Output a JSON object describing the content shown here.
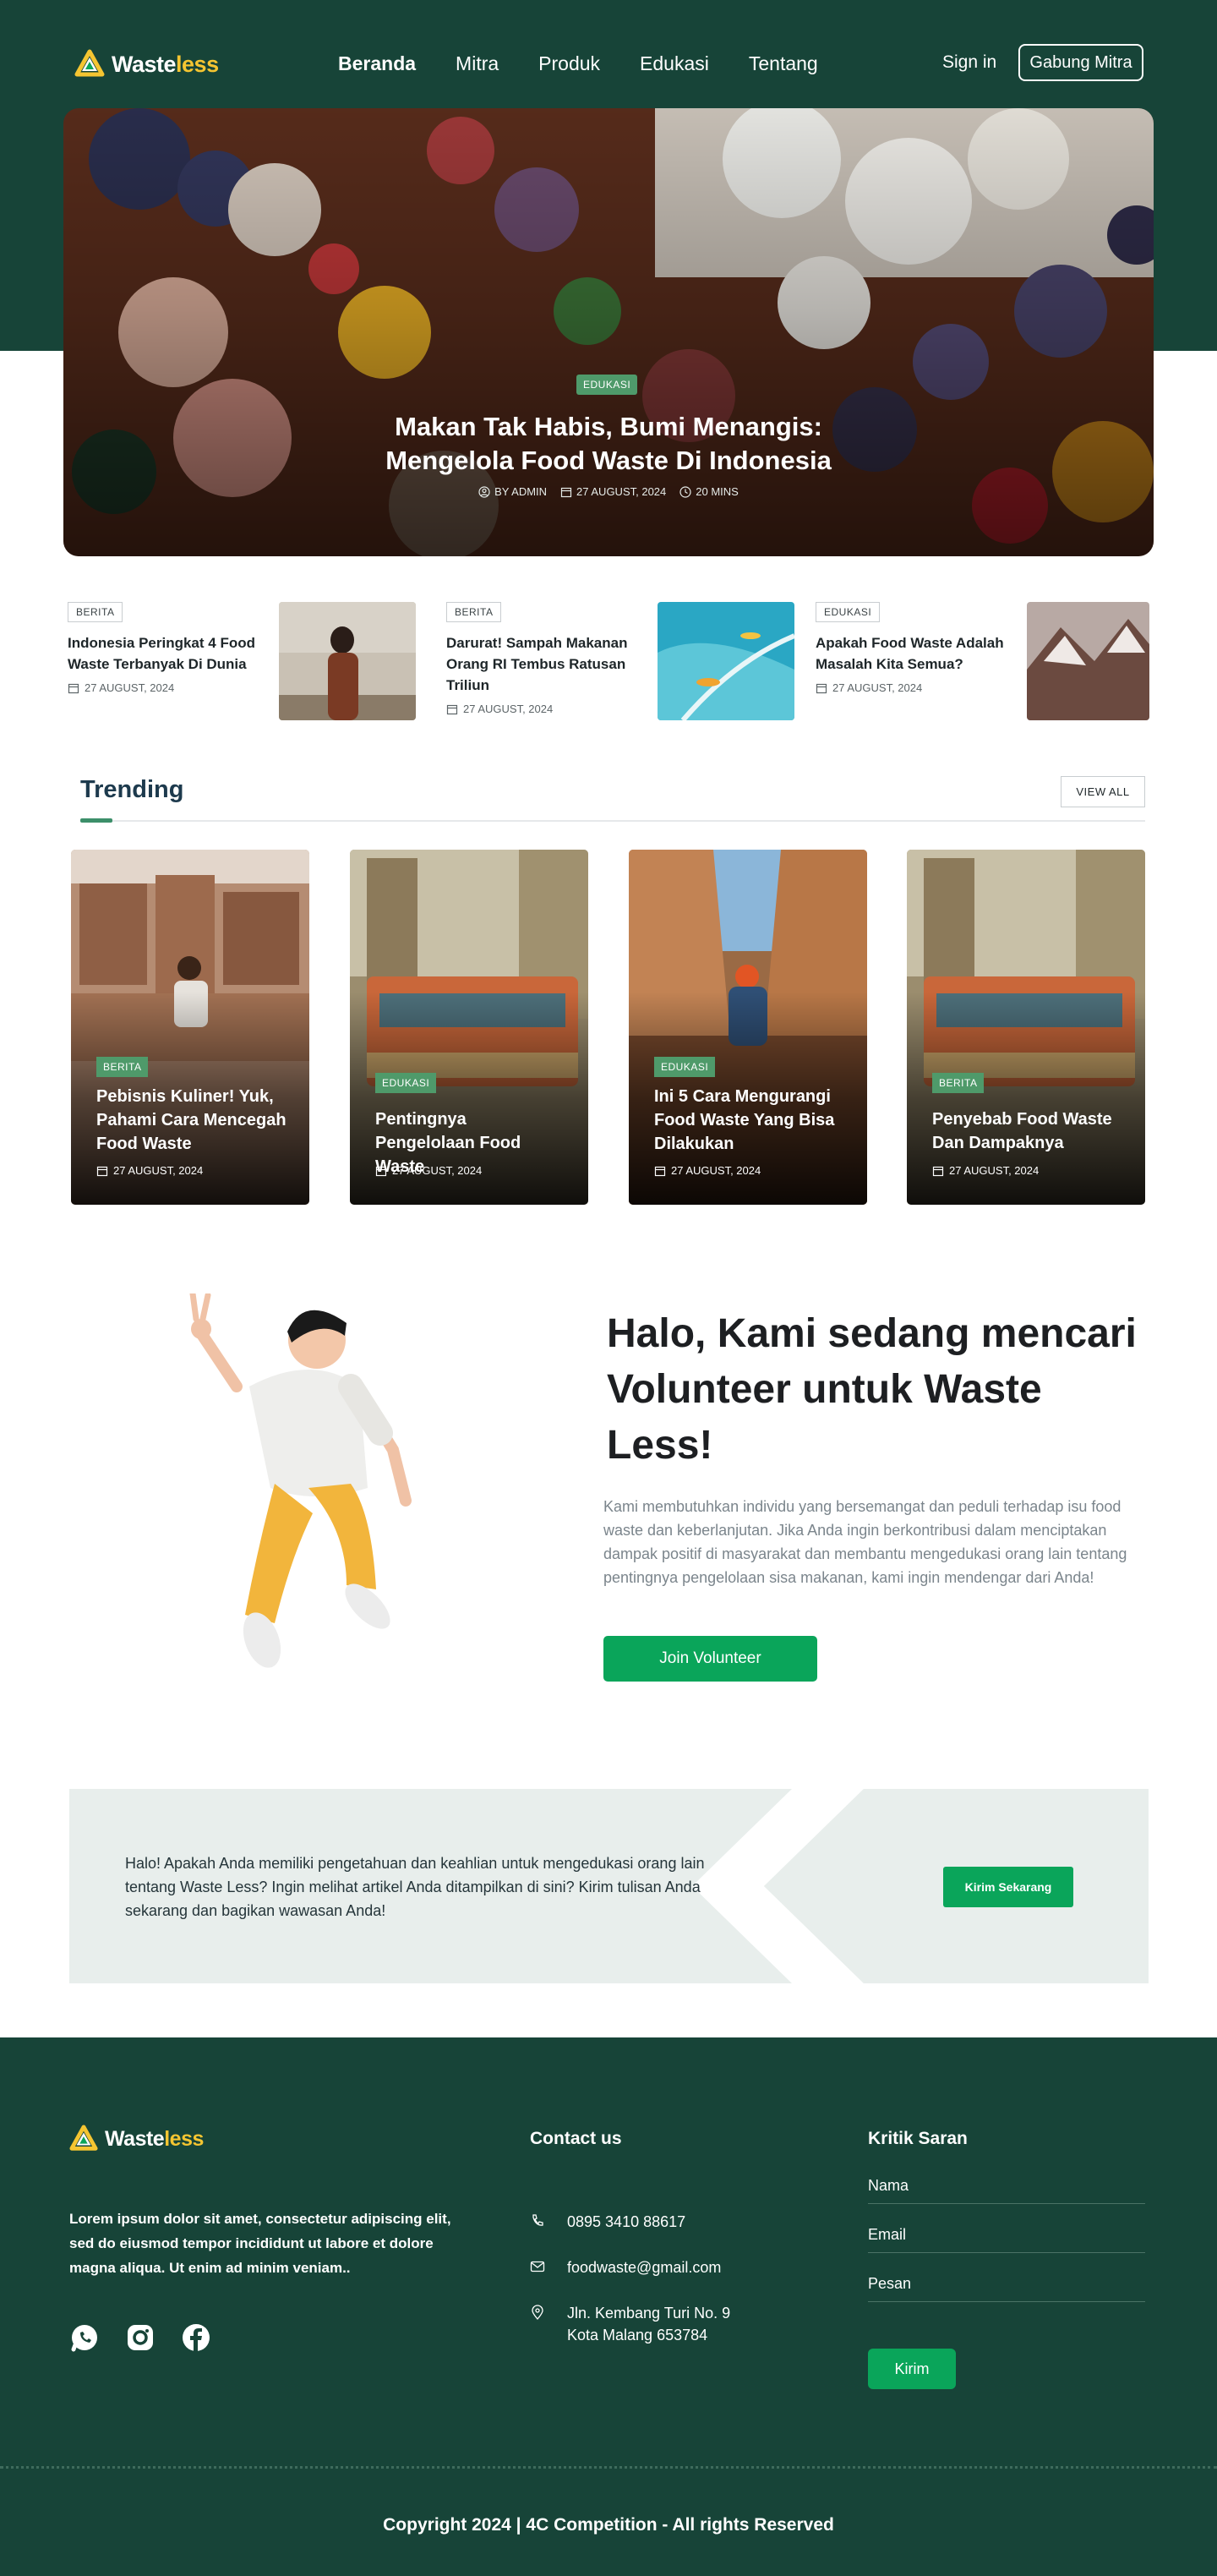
{
  "nav": {
    "logo": {
      "word_a": "Waste",
      "word_b": "less"
    },
    "links": [
      {
        "label": "Beranda",
        "active": true
      },
      {
        "label": "Mitra",
        "active": false
      },
      {
        "label": "Produk",
        "active": false
      },
      {
        "label": "Edukasi",
        "active": false
      },
      {
        "label": "Tentang",
        "active": false
      }
    ],
    "sign_in": "Sign in",
    "join_button": "Gabung Mitra"
  },
  "hero": {
    "tag": "EDUKASI",
    "title": "Makan Tak Habis, Bumi Menangis: Mengelola Food Waste Di Indonesia",
    "author": "BY ADMIN",
    "date": "27 AUGUST, 2024",
    "read_time": "20 MINS"
  },
  "news": [
    {
      "tag": "BERITA",
      "title": "Indonesia Peringkat 4 Food Waste Terbanyak Di Dunia",
      "date": "27 AUGUST, 2024"
    },
    {
      "tag": "BERITA",
      "title": "Darurat! Sampah Makanan Orang RI Tembus Ratusan Triliun",
      "date": "27 AUGUST, 2024"
    },
    {
      "tag": "EDUKASI",
      "title": "Apakah Food Waste Adalah Masalah Kita Semua?",
      "date": "27 AUGUST, 2024"
    }
  ],
  "trending": {
    "heading": "Trending",
    "view_all": "VIEW ALL",
    "cards": [
      {
        "tag": "BERITA",
        "title": "Pebisnis Kuliner! Yuk, Pahami Cara Mencegah Food Waste",
        "date": "27 AUGUST, 2024"
      },
      {
        "tag": "EDUKASI",
        "title": "Pentingnya Pengelolaan Food Waste",
        "date": "27 AUGUST, 2024"
      },
      {
        "tag": "EDUKASI",
        "title": "Ini 5 Cara Mengurangi Food Waste Yang Bisa Dilakukan",
        "date": "27 AUGUST, 2024"
      },
      {
        "tag": "BERITA",
        "title": "Penyebab Food Waste Dan Dampaknya",
        "date": "27 AUGUST, 2024"
      }
    ]
  },
  "volunteer": {
    "title": "Halo, Kami sedang mencari Volunteer untuk Waste Less!",
    "text": "Kami membutuhkan individu yang bersemangat dan peduli terhadap isu food waste dan keberlanjutan. Jika Anda ingin berkontribusi dalam menciptakan dampak positif di masyarakat dan membantu mengedukasi orang lain tentang pentingnya pengelolaan sisa makanan, kami ingin mendengar dari Anda!",
    "button": "Join Volunteer"
  },
  "cta": {
    "text": "Halo! Apakah Anda memiliki pengetahuan dan keahlian untuk mengedukasi orang lain tentang Waste Less? Ingin melihat artikel Anda ditampilkan di sini? Kirim tulisan Anda sekarang dan bagikan wawasan Anda!",
    "button": "Kirim Sekarang"
  },
  "footer": {
    "description": "Lorem ipsum dolor sit amet, consectetur adipiscing elit, sed do eiusmod tempor incididunt ut labore et dolore magna aliqua. Ut enim ad minim veniam..",
    "contact_title": "Contact us",
    "phone": "0895 3410 88617",
    "email": "foodwaste@gmail.com",
    "address": [
      "Jln. Kembang Turi No. 9",
      "Kota Malang 653784"
    ],
    "feedback_title": "Kritik Saran",
    "fields": [
      "Nama",
      "Email",
      "Pesan"
    ],
    "submit": "Kirim",
    "copyright": "Copyright 2024 | 4C Competition - All rights Reserved"
  },
  "colors": {
    "primary_dark": "#174438",
    "accent_green": "#0aa55a",
    "tag_green": "#4f9a6a",
    "logo_yellow": "#f5c531"
  },
  "icons": [
    "calendar-icon",
    "user-icon",
    "clock-icon",
    "phone-icon",
    "mail-icon",
    "location-icon",
    "whatsapp-icon",
    "instagram-icon",
    "facebook-icon"
  ]
}
